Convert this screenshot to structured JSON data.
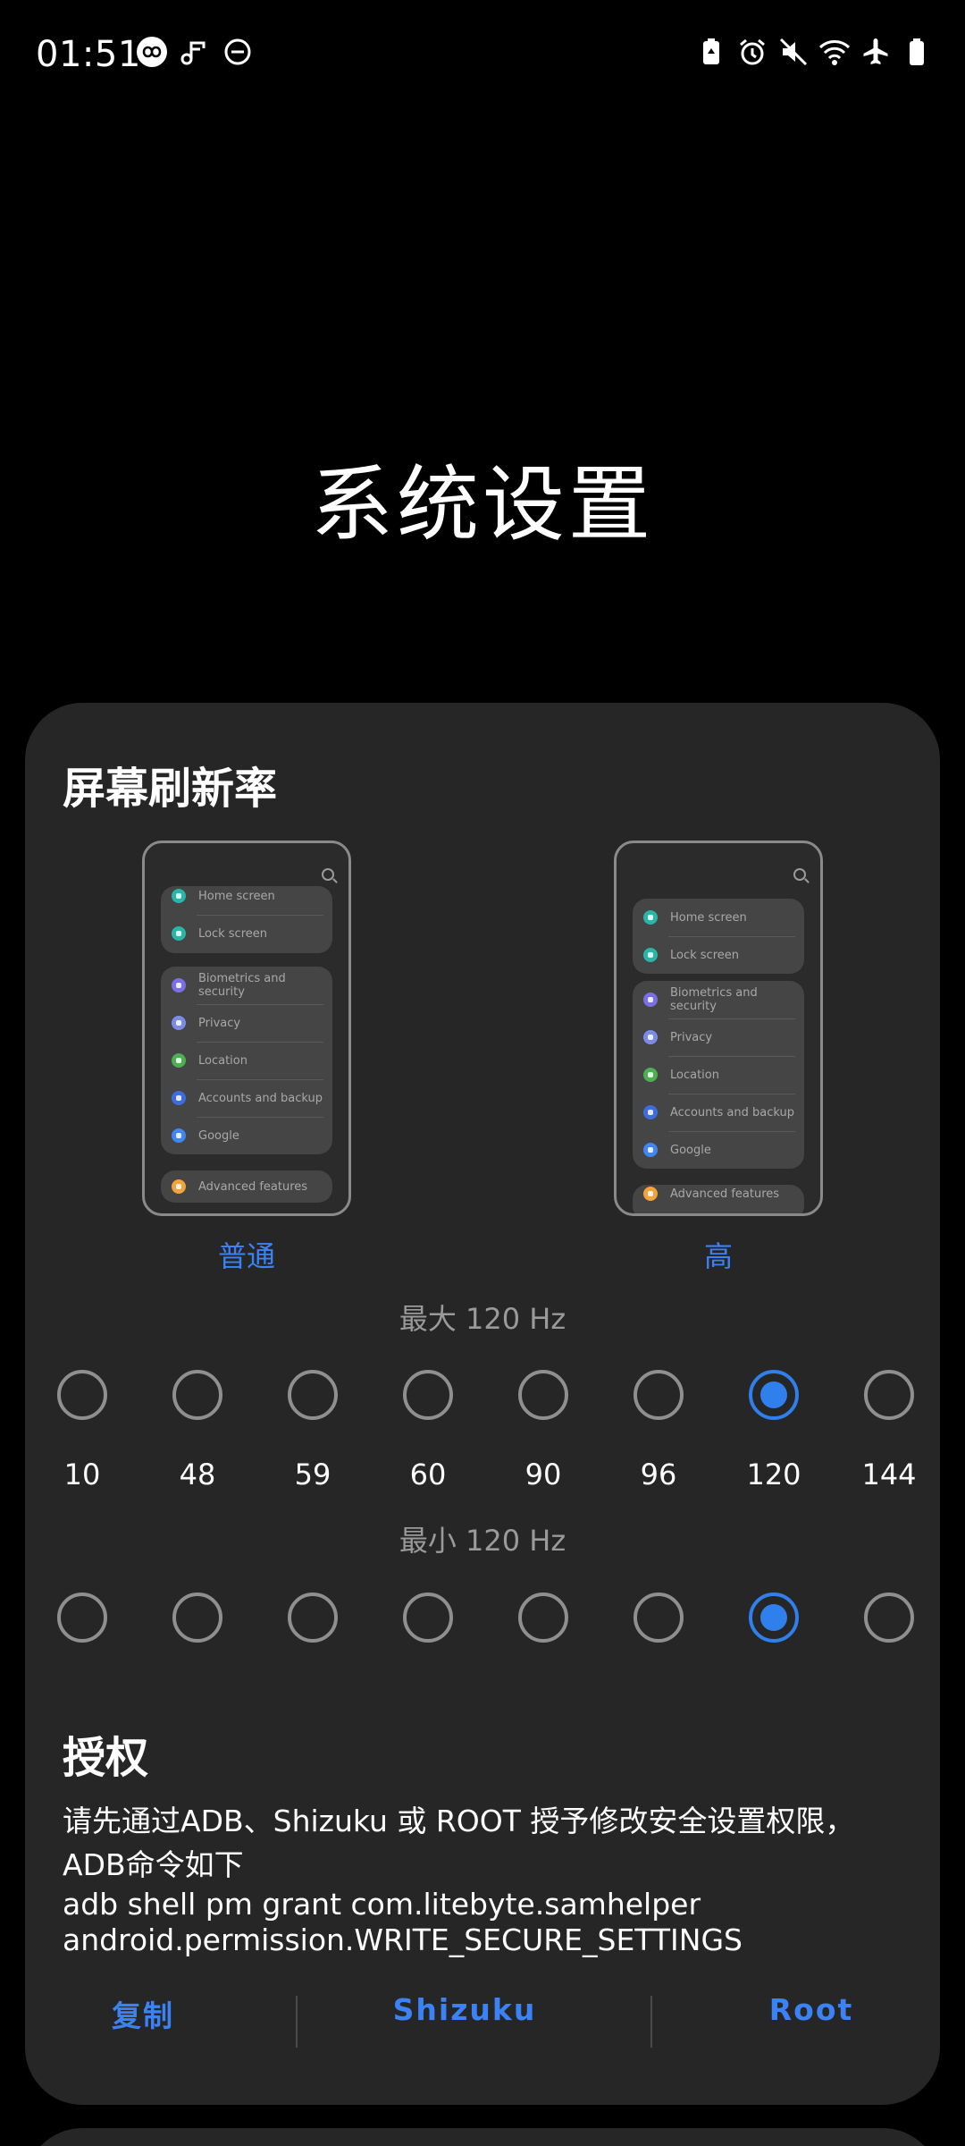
{
  "status_bar": {
    "time": "01:51",
    "left_icons": [
      "infinity-badge-icon",
      "music-note-icon",
      "do-not-disturb-icon"
    ],
    "right_icons": [
      "battery-saver-icon",
      "alarm-icon",
      "mute-icon",
      "wifi-icon",
      "airplane-icon",
      "battery-icon"
    ]
  },
  "page_title": "系统设置",
  "refresh_rate": {
    "title": "屏幕刷新率",
    "modes": [
      {
        "label": "普通",
        "items_group1": [
          "Home screen",
          "Lock screen"
        ],
        "items_group2": [
          "Biometrics and security",
          "Privacy",
          "Location",
          "Accounts and backup",
          "Google"
        ],
        "items_group3": [
          "Advanced features"
        ]
      },
      {
        "label": "高",
        "items_group1": [
          "Home screen",
          "Lock screen"
        ],
        "items_group2": [
          "Biometrics and security",
          "Privacy",
          "Location",
          "Accounts and backup",
          "Google"
        ],
        "items_group3": [
          "Advanced features"
        ]
      }
    ],
    "max_label": "最大 120 Hz",
    "min_label": "最小 120 Hz",
    "values": [
      "10",
      "48",
      "59",
      "60",
      "90",
      "96",
      "120",
      "144"
    ],
    "max_selected": "120",
    "min_selected": "120"
  },
  "auth": {
    "title": "授权",
    "description_line1": "请先通过ADB、Shizuku 或 ROOT 授予修改安全设置权限，",
    "description_line2": "ADB命令如下",
    "command_line1": "adb shell pm grant com.litebyte.samhelper",
    "command_line2": "android.permission.WRITE_SECURE_SETTINGS",
    "actions": [
      "复制",
      "Shizuku",
      "Root"
    ]
  },
  "colors": {
    "accent": "#2f7fed",
    "card_bg": "#262626",
    "page_bg": "#000000",
    "icon_colors": [
      "#29b6a8",
      "#29b6a8",
      "#7b6fe8",
      "#7b8be8",
      "#4caf50",
      "#3f6be0",
      "#4285f4",
      "#f2a33a"
    ]
  }
}
